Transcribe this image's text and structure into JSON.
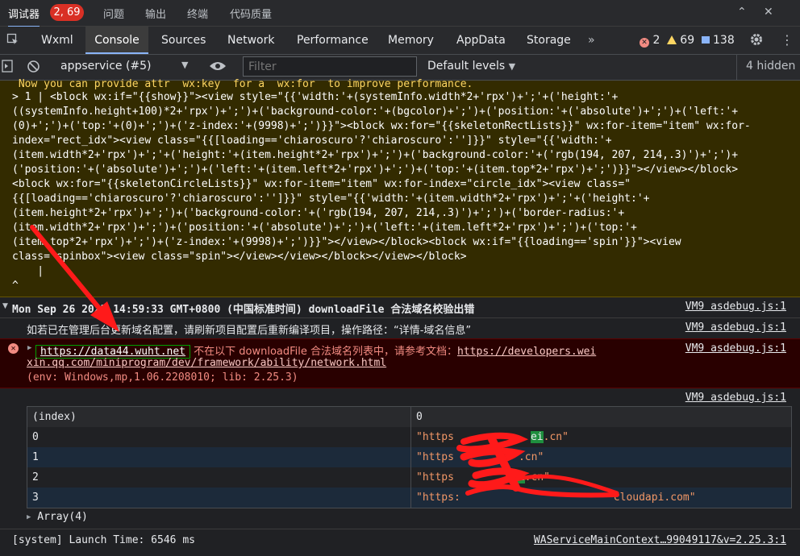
{
  "topbar": {
    "debugger_label": "调试器",
    "badge": "2, 69",
    "items": [
      "问题",
      "输出",
      "终端",
      "代码质量"
    ]
  },
  "tabs": {
    "items": [
      "Wxml",
      "Console",
      "Sources",
      "Network",
      "Performance",
      "Memory",
      "AppData",
      "Storage"
    ],
    "more": "»",
    "errors": "2",
    "warnings": "69",
    "infos": "138"
  },
  "toolbar": {
    "context": "appservice (#5)",
    "filter_placeholder": "Filter",
    "levels": "Default levels",
    "hidden": "4 hidden"
  },
  "warning_block": {
    "lines": [
      " Now you can provide attr  wx:key  for a  wx:for  to improve performance.",
      "> 1 | <block wx:if=\"{{show}}\"><view style=\"{{'width:'+(systemInfo.width*2+'rpx')+';'+('height:'+",
      "((systemInfo.height+100)*2+'rpx')+';')+('background-color:'+(bgcolor)+';')+('position:'+('absolute')+';')+('left:'+",
      "(0)+';')+('top:'+(0)+';')+('z-index:'+(9998)+';')}}\"><block wx:for=\"{{skeletonRectLists}}\" wx:for-item=\"item\" wx:for-",
      "index=\"rect_idx\"><view class=\"{{[loading=='chiaroscuro'?'chiaroscuro':'']}}\" style=\"{{'width:'+",
      "(item.width*2+'rpx')+';'+('height:'+(item.height*2+'rpx')+';')+('background-color:'+('rgb(194, 207, 214,.3)')+';')+",
      "('position:'+('absolute')+';')+('left:'+(item.left*2+'rpx')+';')+('top:'+(item.top*2+'rpx')+';')}}\"></view></block>",
      "<block wx:for=\"{{skeletonCircleLists}}\" wx:for-item=\"item\" wx:for-index=\"circle_idx\"><view class=\"",
      "{{[loading=='chiaroscuro'?'chiaroscuro':'']}}\" style=\"{{'width:'+(item.width*2+'rpx')+';'+('height:'+",
      "(item.height*2+'rpx')+';')+('background-color:'+('rgb(194, 207, 214,.3)')+';')+('border-radius:'+",
      "(item.width*2+'rpx')+';')+('position:'+('absolute')+';')+('left:'+(item.left*2+'rpx')+';')+('top:'+",
      "(item.top*2+'rpx')+';')+('z-index:'+(9998)+';')}}\"></view></block><block wx:if=\"{{loading=='spin'}}\"><view",
      "class=\"spinbox\"><view class=\"spin\"></view></view></block></view></block>",
      "    |",
      "^"
    ]
  },
  "group": {
    "header": "Mon Sep 26 2022 14:59:33 GMT+0800 (中国标准时间) downloadFile 合法域名校验出错",
    "source": "VM9 asdebug.js:1"
  },
  "info_line": {
    "text": "如若已在管理后台更新域名配置，请刷新项目配置后重新编译项目，操作路径：“详情-域名信息”",
    "source": "VM9 asdebug.js:1"
  },
  "error": {
    "url": "https://data44.wuht.net",
    "message": " 不在以下 downloadFile 合法域名列表中，请参考文档：",
    "doc_link_1": "https://developers.wei",
    "doc_link_2": "xin.qq.com/miniprogram/dev/framework/ability/network.html",
    "env": "(env: Windows,mp,1.06.2208010; lib: 2.25.3)",
    "source": "VM9 asdebug.js:1"
  },
  "table_source": "VM9 asdebug.js:1",
  "table": {
    "headers": [
      "(index)",
      "0"
    ],
    "rows": [
      {
        "index": "0",
        "prefix": "\"https",
        "hl": "ei",
        "suffix": ".cn\""
      },
      {
        "index": "1",
        "prefix": "\"https",
        "hl": "",
        "suffix": ".cn\""
      },
      {
        "index": "2",
        "prefix": "\"https",
        "hl": "ei",
        "suffix": ".cn\""
      },
      {
        "index": "3",
        "prefix": "\"https:",
        "hl": "",
        "suffix": "cloudapi.com\""
      }
    ]
  },
  "array_label": "Array(4)",
  "footer": {
    "text": "[system] Launch Time: 6546 ms",
    "source": "WAServiceMainContext…99049117&v=2.25.3:1"
  },
  "colors": {
    "warning_bg": "#332b00",
    "warning_text": "#fdd663",
    "error_bg": "#290000",
    "error_text": "#f28b82",
    "accent": "#8ab4f8"
  }
}
